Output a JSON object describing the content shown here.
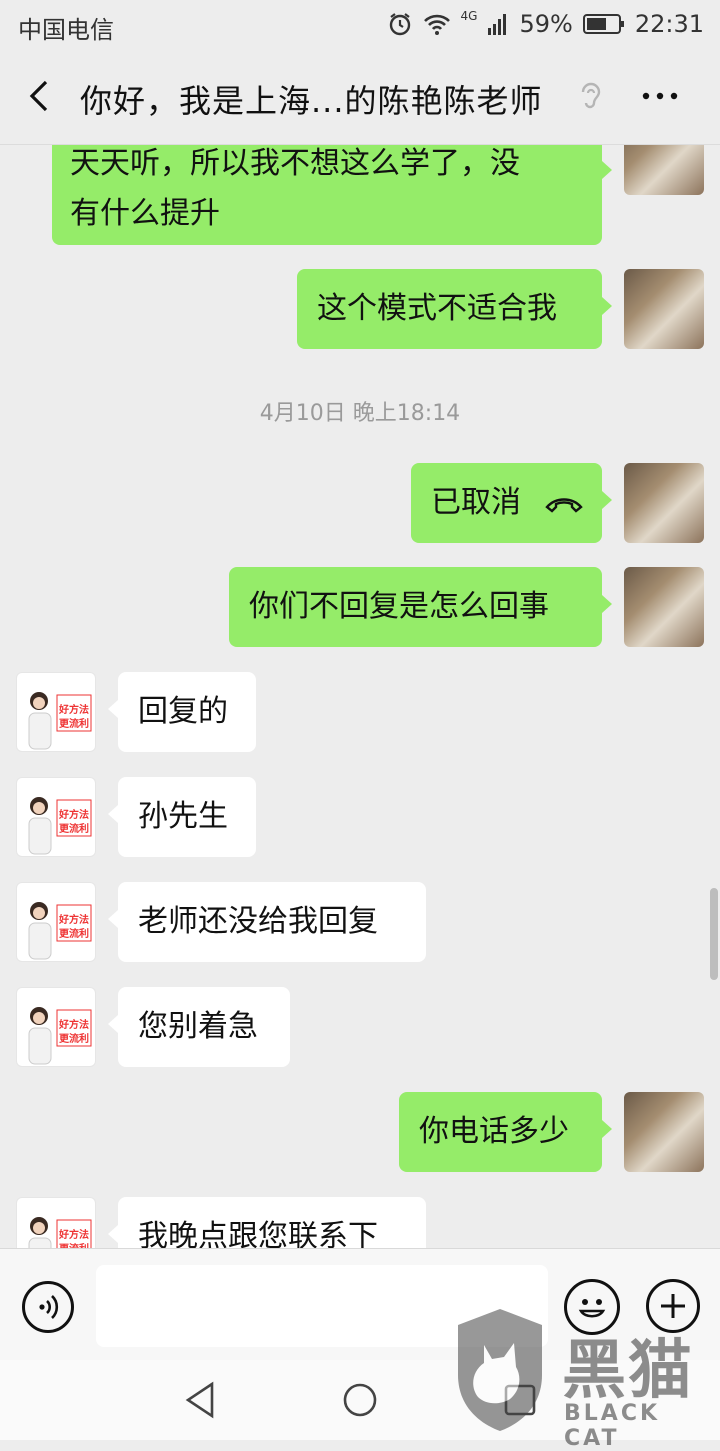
{
  "status_bar": {
    "carrier": "中国电信",
    "battery": "59%",
    "time": "22:31",
    "network": "4G"
  },
  "header": {
    "title": "你好，我是上海...的陈艳陈老师"
  },
  "messages": [
    {
      "direction": "out",
      "text_lines": [
        "天天听，所以我不想这么学了，没",
        "有什么提升"
      ]
    },
    {
      "direction": "out",
      "text": "这个模式不适合我"
    },
    {
      "timestamp": "4月10日 晚上18:14"
    },
    {
      "direction": "out",
      "text": "已取消",
      "type": "call-cancelled"
    },
    {
      "direction": "out",
      "text": "你们不回复是怎么回事"
    },
    {
      "direction": "in",
      "text": "回复的"
    },
    {
      "direction": "in",
      "text": "孙先生"
    },
    {
      "direction": "in",
      "text": "老师还没给我回复"
    },
    {
      "direction": "in",
      "text": "您别着急"
    },
    {
      "direction": "out",
      "text": "你电话多少"
    },
    {
      "direction": "in",
      "text": "我晚点跟您联系下"
    }
  ],
  "teacher_avatar_text": [
    "好方法",
    "更流利"
  ],
  "watermark": {
    "cn": "黑猫",
    "en": "BLACK CAT"
  },
  "colors": {
    "outgoing_bubble": "#95ec69",
    "incoming_bubble": "#ffffff",
    "background": "#ededed"
  }
}
